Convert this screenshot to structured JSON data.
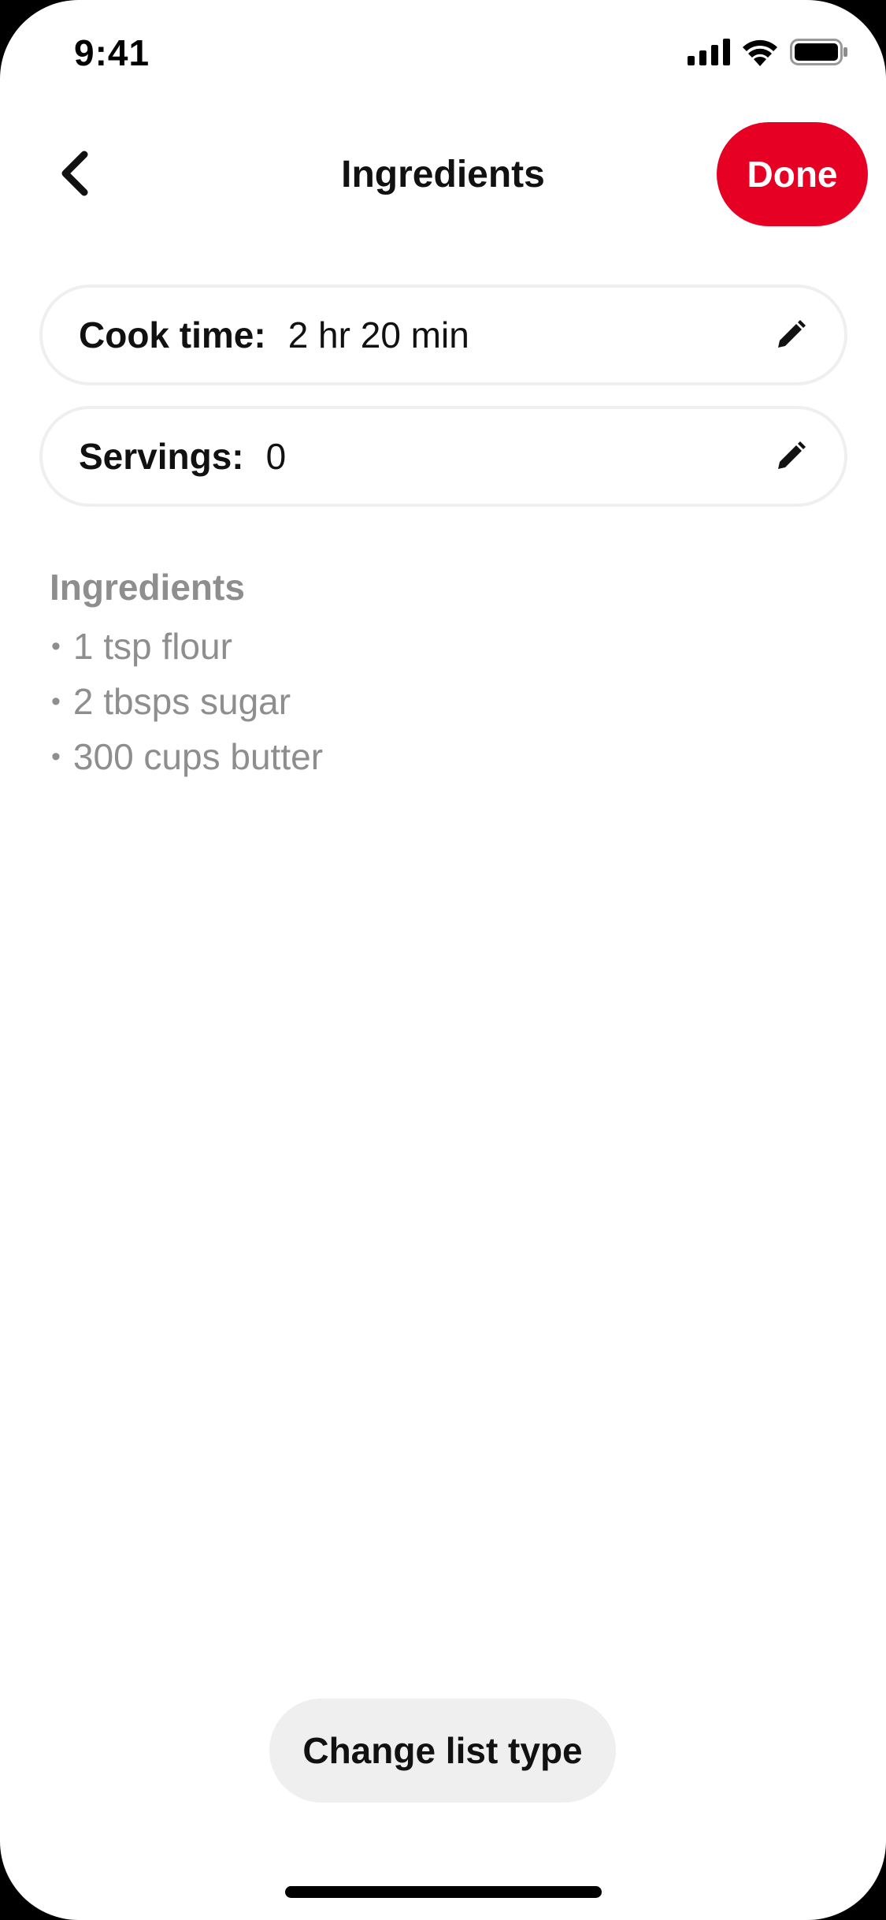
{
  "status_bar": {
    "time": "9:41"
  },
  "header": {
    "title": "Ingredients",
    "done_label": "Done",
    "back_icon": "chevron-left-icon"
  },
  "fields": {
    "cook_time": {
      "label": "Cook time:",
      "value": "2 hr 20 min",
      "icon": "pencil-icon"
    },
    "servings": {
      "label": "Servings:",
      "value": "0",
      "icon": "pencil-icon"
    }
  },
  "ingredients": {
    "heading": "Ingredients",
    "bullet": "•",
    "items": [
      {
        "text": "1 tsp flour"
      },
      {
        "text": "2 tbsps sugar"
      },
      {
        "text": "300 cups butter"
      }
    ]
  },
  "footer": {
    "change_list_label": "Change list type"
  },
  "colors": {
    "accent": "#e60023",
    "text_primary": "#111111",
    "text_muted": "#8e8e8e",
    "field_border": "#efefef",
    "pill_background": "#efefef"
  }
}
